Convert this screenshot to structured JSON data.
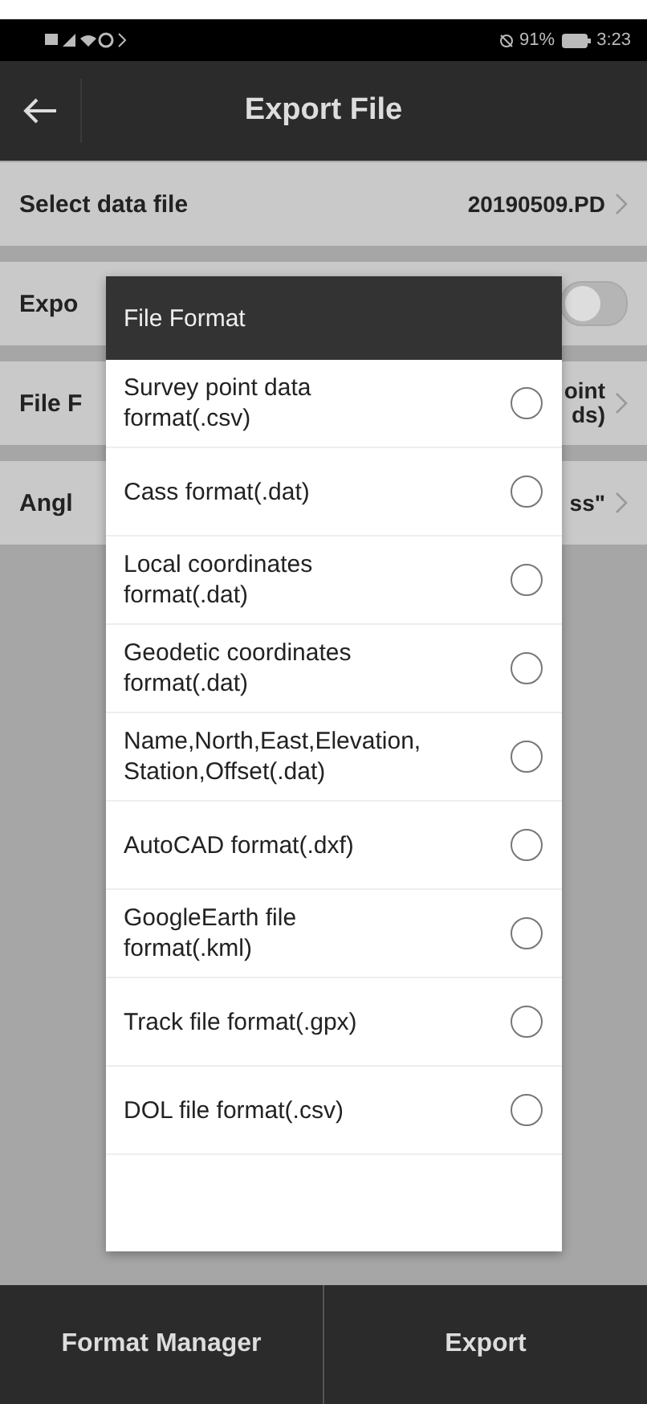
{
  "status_bar": {
    "battery": "91%",
    "time": "3:23"
  },
  "header": {
    "title": "Export File"
  },
  "settings": [
    {
      "kind": "value",
      "label": "Select data file",
      "value": [
        "20190509.PD"
      ]
    },
    {
      "kind": "toggle",
      "label": "Expo",
      "on": false
    },
    {
      "kind": "value",
      "label": "File F",
      "value": [
        "oint",
        "ds)"
      ]
    },
    {
      "kind": "value",
      "label": "Angl",
      "value": [
        "ss\""
      ]
    }
  ],
  "dialog": {
    "title": "File Format",
    "options": [
      {
        "label": "Survey point data format(.csv)",
        "selected": false
      },
      {
        "label": "Cass format(.dat)",
        "selected": false
      },
      {
        "label": "Local coordinates format(.dat)",
        "selected": false
      },
      {
        "label": "Geodetic coordinates format(.dat)",
        "selected": false
      },
      {
        "label": "Name,North,East,Elevation,Station,Offset(.dat)",
        "selected": false
      },
      {
        "label": "AutoCAD format(.dxf)",
        "selected": false
      },
      {
        "label": "GoogleEarth file format(.kml)",
        "selected": false
      },
      {
        "label": "Track file format(.gpx)",
        "selected": false
      },
      {
        "label": "DOL file format(.csv)",
        "selected": false
      }
    ]
  },
  "bottom_buttons": [
    "Format Manager",
    "Export"
  ]
}
